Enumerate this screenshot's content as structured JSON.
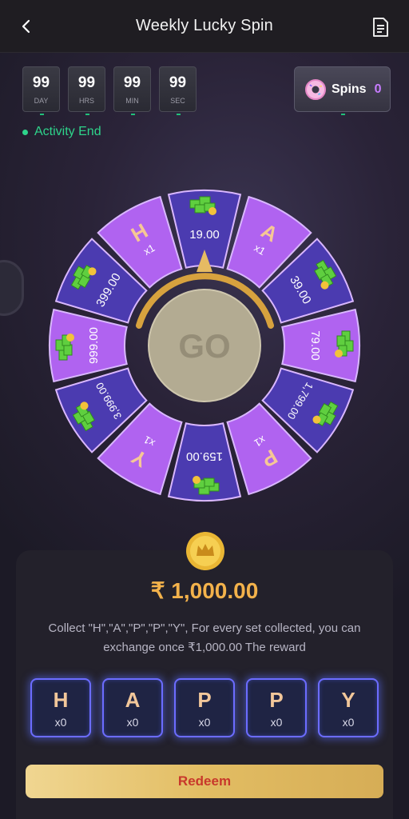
{
  "header": {
    "title": "Weekly Lucky Spin",
    "back_icon": "chevron-left-icon",
    "doc_icon": "document-icon"
  },
  "timer": [
    {
      "value": "99",
      "unit": "DAY"
    },
    {
      "value": "99",
      "unit": "HRS"
    },
    {
      "value": "99",
      "unit": "MIN"
    },
    {
      "value": "99",
      "unit": "SEC"
    }
  ],
  "activity": {
    "label": "Activity End"
  },
  "spins": {
    "label": "Spins",
    "count": "0",
    "icon": "donut-icon"
  },
  "wheel": {
    "center_label": "GO",
    "segments": [
      {
        "type": "amount",
        "text": "19.00",
        "color": "#4b3bb0"
      },
      {
        "type": "letter",
        "text": "A",
        "sub": "x1",
        "color": "#b063f0"
      },
      {
        "type": "amount",
        "text": "39.00",
        "color": "#4b3bb0"
      },
      {
        "type": "amount",
        "text": "79.00",
        "color": "#b063f0"
      },
      {
        "type": "amount",
        "text": "1,799.00",
        "color": "#4b3bb0"
      },
      {
        "type": "letter",
        "text": "P",
        "sub": "x1",
        "color": "#b063f0"
      },
      {
        "type": "amount",
        "text": "159.00",
        "color": "#4b3bb0"
      },
      {
        "type": "letter",
        "text": "Y",
        "sub": "x1",
        "color": "#b063f0"
      },
      {
        "type": "amount",
        "text": "3,999.00",
        "color": "#4b3bb0"
      },
      {
        "type": "amount",
        "text": "999.00",
        "color": "#b063f0"
      },
      {
        "type": "amount",
        "text": "399.00",
        "color": "#4b3bb0"
      },
      {
        "type": "letter",
        "text": "H",
        "sub": "x1",
        "color": "#b063f0"
      }
    ]
  },
  "reward": {
    "amount": "₹ 1,000.00",
    "description": "Collect \"H\",\"A\",\"P\",\"P\",\"Y\", For every set collected, you can exchange once ₹1,000.00 The reward",
    "coin_icon": "crown-coin-icon"
  },
  "letters": [
    {
      "letter": "H",
      "count": "x0"
    },
    {
      "letter": "A",
      "count": "x0"
    },
    {
      "letter": "P",
      "count": "x0"
    },
    {
      "letter": "P",
      "count": "x0"
    },
    {
      "letter": "Y",
      "count": "x0"
    }
  ],
  "redeem": {
    "label": "Redeem"
  },
  "colors": {
    "accent_gold": "#f3b24b",
    "activity_green": "#2ed48b",
    "letter_border": "#6c6cff",
    "redeem_text": "#c8382b"
  }
}
